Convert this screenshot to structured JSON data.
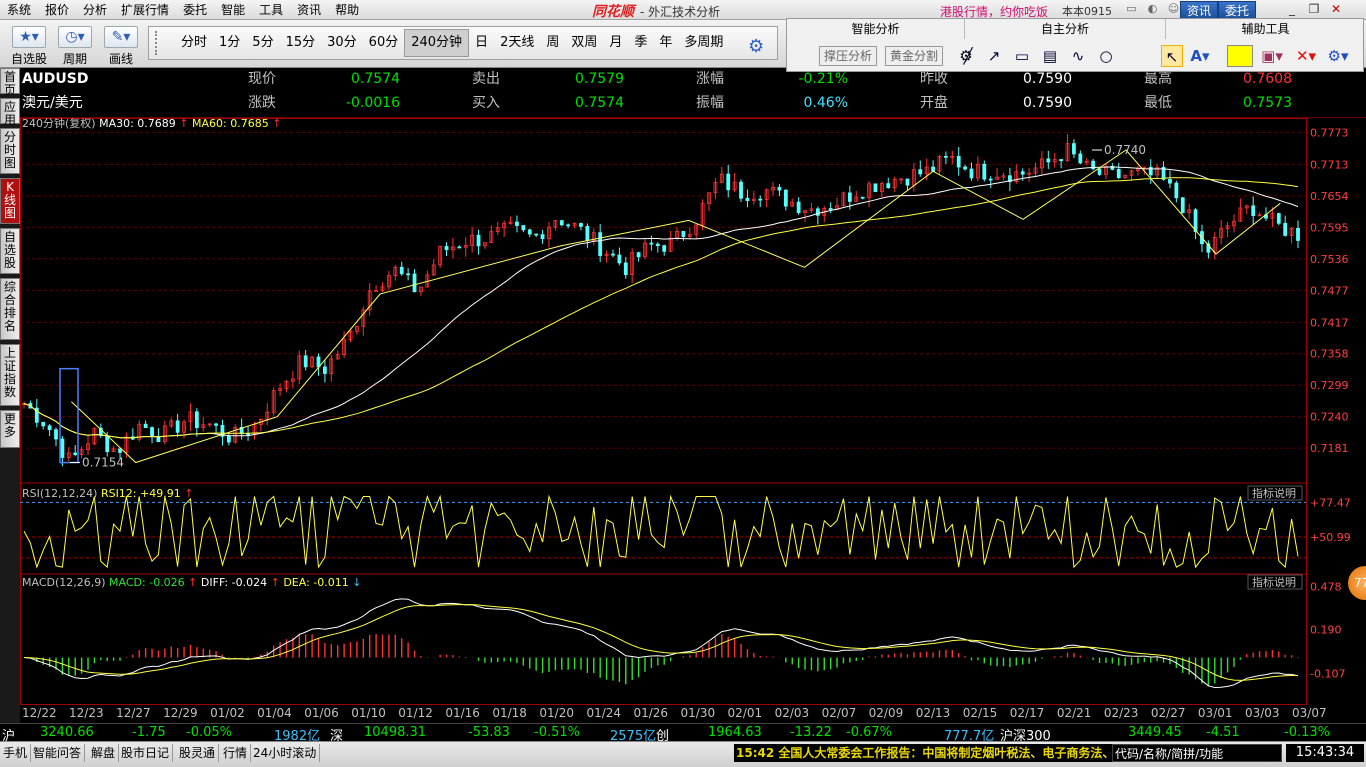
{
  "menu": [
    "系统",
    "报价",
    "分析",
    "扩展行情",
    "委托",
    "智能",
    "工具",
    "资讯",
    "帮助"
  ],
  "brand": "同花顺",
  "app_title": "- 外汇技术分析",
  "promo": "港股行情，约你吃饭",
  "version": "本本0915",
  "top_buttons": {
    "news": "资讯",
    "trade": "委托"
  },
  "toolbar": {
    "watchlist": "自选股",
    "cycle": "周期",
    "draw": "画线"
  },
  "periods": [
    "分时",
    "1分",
    "5分",
    "15分",
    "30分",
    "60分",
    "240分钟",
    "日",
    "2天线",
    "周",
    "双周",
    "月",
    "季",
    "年",
    "多周期"
  ],
  "selected_period": "240分钟",
  "panel": {
    "smart_title": "智能分析",
    "self_title": "自主分析",
    "aux_title": "辅助工具",
    "support_btn": "撑压分析",
    "golden_btn": "黄金分割",
    "tool_icons": [
      "line-tool-icon",
      "ray-tool-icon",
      "rect-tool-icon",
      "channel-tool-icon",
      "wave-tool-icon",
      "ellipse-tool-icon"
    ],
    "highlight_color": "#ffff00"
  },
  "sidebar": [
    "首页",
    "应用",
    "分时图",
    "K线图",
    "自选股",
    "综合排名",
    "上证指数",
    "更多"
  ],
  "quote": {
    "symbol": "AUDUSD",
    "name": "澳元/美元",
    "r1": [
      {
        "l": "现价",
        "v": "0.7574",
        "c": "#00e000"
      },
      {
        "l": "卖出",
        "v": "0.7579",
        "c": "#00e000"
      },
      {
        "l": "涨幅",
        "v": "-0.21%",
        "c": "#00e000"
      },
      {
        "l": "昨收",
        "v": "0.7590",
        "c": "#ffffff"
      },
      {
        "l": "最高",
        "v": "0.7608",
        "c": "#ff3030"
      }
    ],
    "r2": [
      {
        "l": "涨跌",
        "v": "-0.0016",
        "c": "#00e000"
      },
      {
        "l": "买入",
        "v": "0.7574",
        "c": "#00e000"
      },
      {
        "l": "振幅",
        "v": "0.46%",
        "c": "#40e0ff"
      },
      {
        "l": "开盘",
        "v": "0.7590",
        "c": "#ffffff"
      },
      {
        "l": "最低",
        "v": "0.7573",
        "c": "#00e000"
      }
    ]
  },
  "indicator_main": {
    "label": "240分钟(复权)",
    "ma30": "MA30: 0.7689",
    "ma60": "MA60: 0.7685"
  },
  "indicator_rsi": {
    "label": "RSI(12,12,24)",
    "value": "RSI12: +49.91",
    "help": "指标说明"
  },
  "indicator_macd": {
    "label": "MACD(12,26,9)",
    "macd": "MACD: -0.026",
    "diff": "DIFF: -0.024",
    "dea": "DEA: -0.011",
    "help": "指标说明"
  },
  "orb": "77",
  "status": [
    {
      "t": "沪",
      "c": "#ffffff"
    },
    {
      "t": "3240.66",
      "c": "#00e000"
    },
    {
      "t": "-1.75",
      "c": "#00e000"
    },
    {
      "t": "-0.05%",
      "c": "#00e000"
    },
    {
      "t": "1982亿",
      "c": "#40c0ff"
    },
    {
      "t": "深",
      "c": "#ffffff"
    },
    {
      "t": "10498.31",
      "c": "#00e000"
    },
    {
      "t": "-53.83",
      "c": "#00e000"
    },
    {
      "t": "-0.51%",
      "c": "#00e000"
    },
    {
      "t": "2575亿",
      "c": "#40c0ff"
    },
    {
      "t": "创",
      "c": "#ffffff"
    },
    {
      "t": "1964.63",
      "c": "#00e000"
    },
    {
      "t": "-13.22",
      "c": "#00e000"
    },
    {
      "t": "-0.67%",
      "c": "#00e000"
    },
    {
      "t": "777.7亿",
      "c": "#40c0ff"
    },
    {
      "t": "沪深300",
      "c": "#ffffff"
    },
    {
      "t": "3449.45",
      "c": "#00e000"
    },
    {
      "t": "-4.51",
      "c": "#00e000"
    },
    {
      "t": "-0.13%",
      "c": "#00e000"
    }
  ],
  "bottom_tabs": [
    "手机",
    "智能问答",
    "解盘",
    "股市日记",
    "股灵通",
    "行情",
    "24小时滚动"
  ],
  "news": "15:42 全国人大常委会工作报告：中国将制定烟叶税法、电子商务法、",
  "search_placeholder": "代码/名称/简拼/功能",
  "clock": "15:43:34",
  "chart_data": {
    "type": "candlestick",
    "price_axis": {
      "ticks": [
        0.7773,
        0.7713,
        0.7654,
        0.7595,
        0.7536,
        0.7477,
        0.7417,
        0.7358,
        0.7299,
        0.724,
        0.7181
      ],
      "min": 0.7125,
      "max": 0.7785
    },
    "annotations": [
      {
        "label": "0.7740",
        "value": 0.774
      },
      {
        "label": "0.7154",
        "value": 0.7154
      }
    ],
    "date_labels": [
      "12/22",
      "12/23",
      "12/27",
      "12/29",
      "01/02",
      "01/04",
      "01/06",
      "01/10",
      "01/12",
      "01/16",
      "01/18",
      "01/20",
      "01/24",
      "01/26",
      "01/30",
      "02/01",
      "02/03",
      "02/07",
      "02/09",
      "02/13",
      "02/15",
      "02/17",
      "02/21",
      "02/23",
      "02/27",
      "03/01",
      "03/03",
      "03/07"
    ],
    "rsi_axis": {
      "ticks": [
        "+77.47",
        "+50.99"
      ],
      "top": 77.47,
      "mid": 50.99
    },
    "macd_axis": {
      "ticks": [
        "0.478",
        "0.190",
        "-0.107"
      ]
    },
    "close_path": [
      0.7265,
      0.7225,
      0.7154,
      0.721,
      0.7175,
      0.7225,
      0.7205,
      0.7235,
      0.7225,
      0.72,
      0.7225,
      0.7295,
      0.7345,
      0.733,
      0.7385,
      0.7485,
      0.7515,
      0.7475,
      0.755,
      0.757,
      0.7575,
      0.759,
      0.7575,
      0.7615,
      0.759,
      0.7555,
      0.752,
      0.756,
      0.7565,
      0.761,
      0.7685,
      0.766,
      0.7665,
      0.7645,
      0.763,
      0.764,
      0.7665,
      0.768,
      0.769,
      0.77,
      0.7725,
      0.77,
      0.77,
      0.7695,
      0.771,
      0.774,
      0.77,
      0.769,
      0.7695,
      0.769,
      0.764,
      0.7545,
      0.76,
      0.7635,
      0.76,
      0.7582
    ]
  }
}
